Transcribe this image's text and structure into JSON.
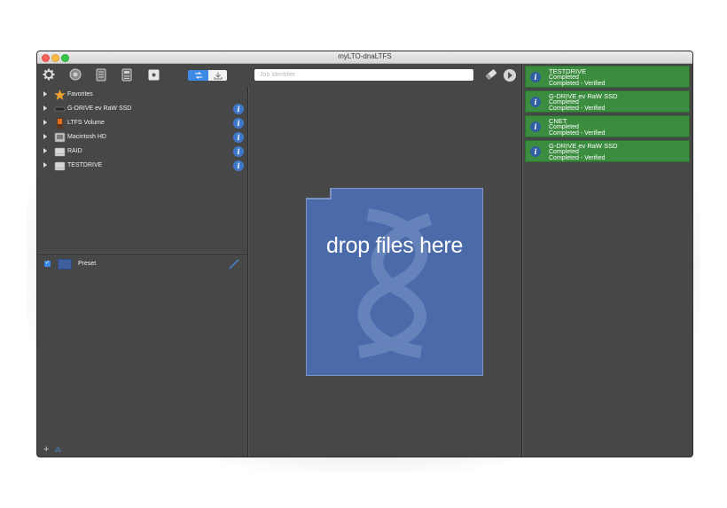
{
  "window": {
    "title": "myLTO-dnaLTFS"
  },
  "toolbar": {
    "icons": [
      "gear-icon",
      "help-icon",
      "tape-drive-icon",
      "tape-library-icon",
      "disk-icon"
    ],
    "segment_icons": [
      "transfer-icon",
      "download-icon"
    ]
  },
  "sources": [
    {
      "label": "Favorites",
      "icon": "star-icon",
      "info": false
    },
    {
      "label": "G-DRIVE ev RaW SSD",
      "icon": "ssd-icon",
      "info": true
    },
    {
      "label": "LTFS Volume",
      "icon": "ltfs-icon",
      "info": true
    },
    {
      "label": "Macintosh HD",
      "icon": "hard-drive-icon",
      "info": true
    },
    {
      "label": "RAID",
      "icon": "drive-icon",
      "info": true
    },
    {
      "label": "TESTDRIVE",
      "icon": "drive-icon",
      "info": true
    }
  ],
  "preset": {
    "label": "Preset",
    "checked": true,
    "color": "#3f5f9e"
  },
  "job": {
    "placeholder": "Job Identifier",
    "value": ""
  },
  "dropzone": {
    "text": "drop files here",
    "color": "#4a6aaa"
  },
  "jobs": [
    {
      "name": "TESTDRIVE",
      "status1": "Completed",
      "status2": "Completed - Verified"
    },
    {
      "name": "G-DRIVE ev RaW SSD",
      "status1": "Completed",
      "status2": "Completed - Verified"
    },
    {
      "name": "CNET",
      "status1": "Completed",
      "status2": "Completed - Verified"
    },
    {
      "name": "G-DRIVE ev RaW SSD",
      "status1": "Completed",
      "status2": "Completed - Verified"
    }
  ],
  "colors": {
    "job_done": "#3c8c3f",
    "accent": "#3b8ae6",
    "background": "#474747"
  }
}
